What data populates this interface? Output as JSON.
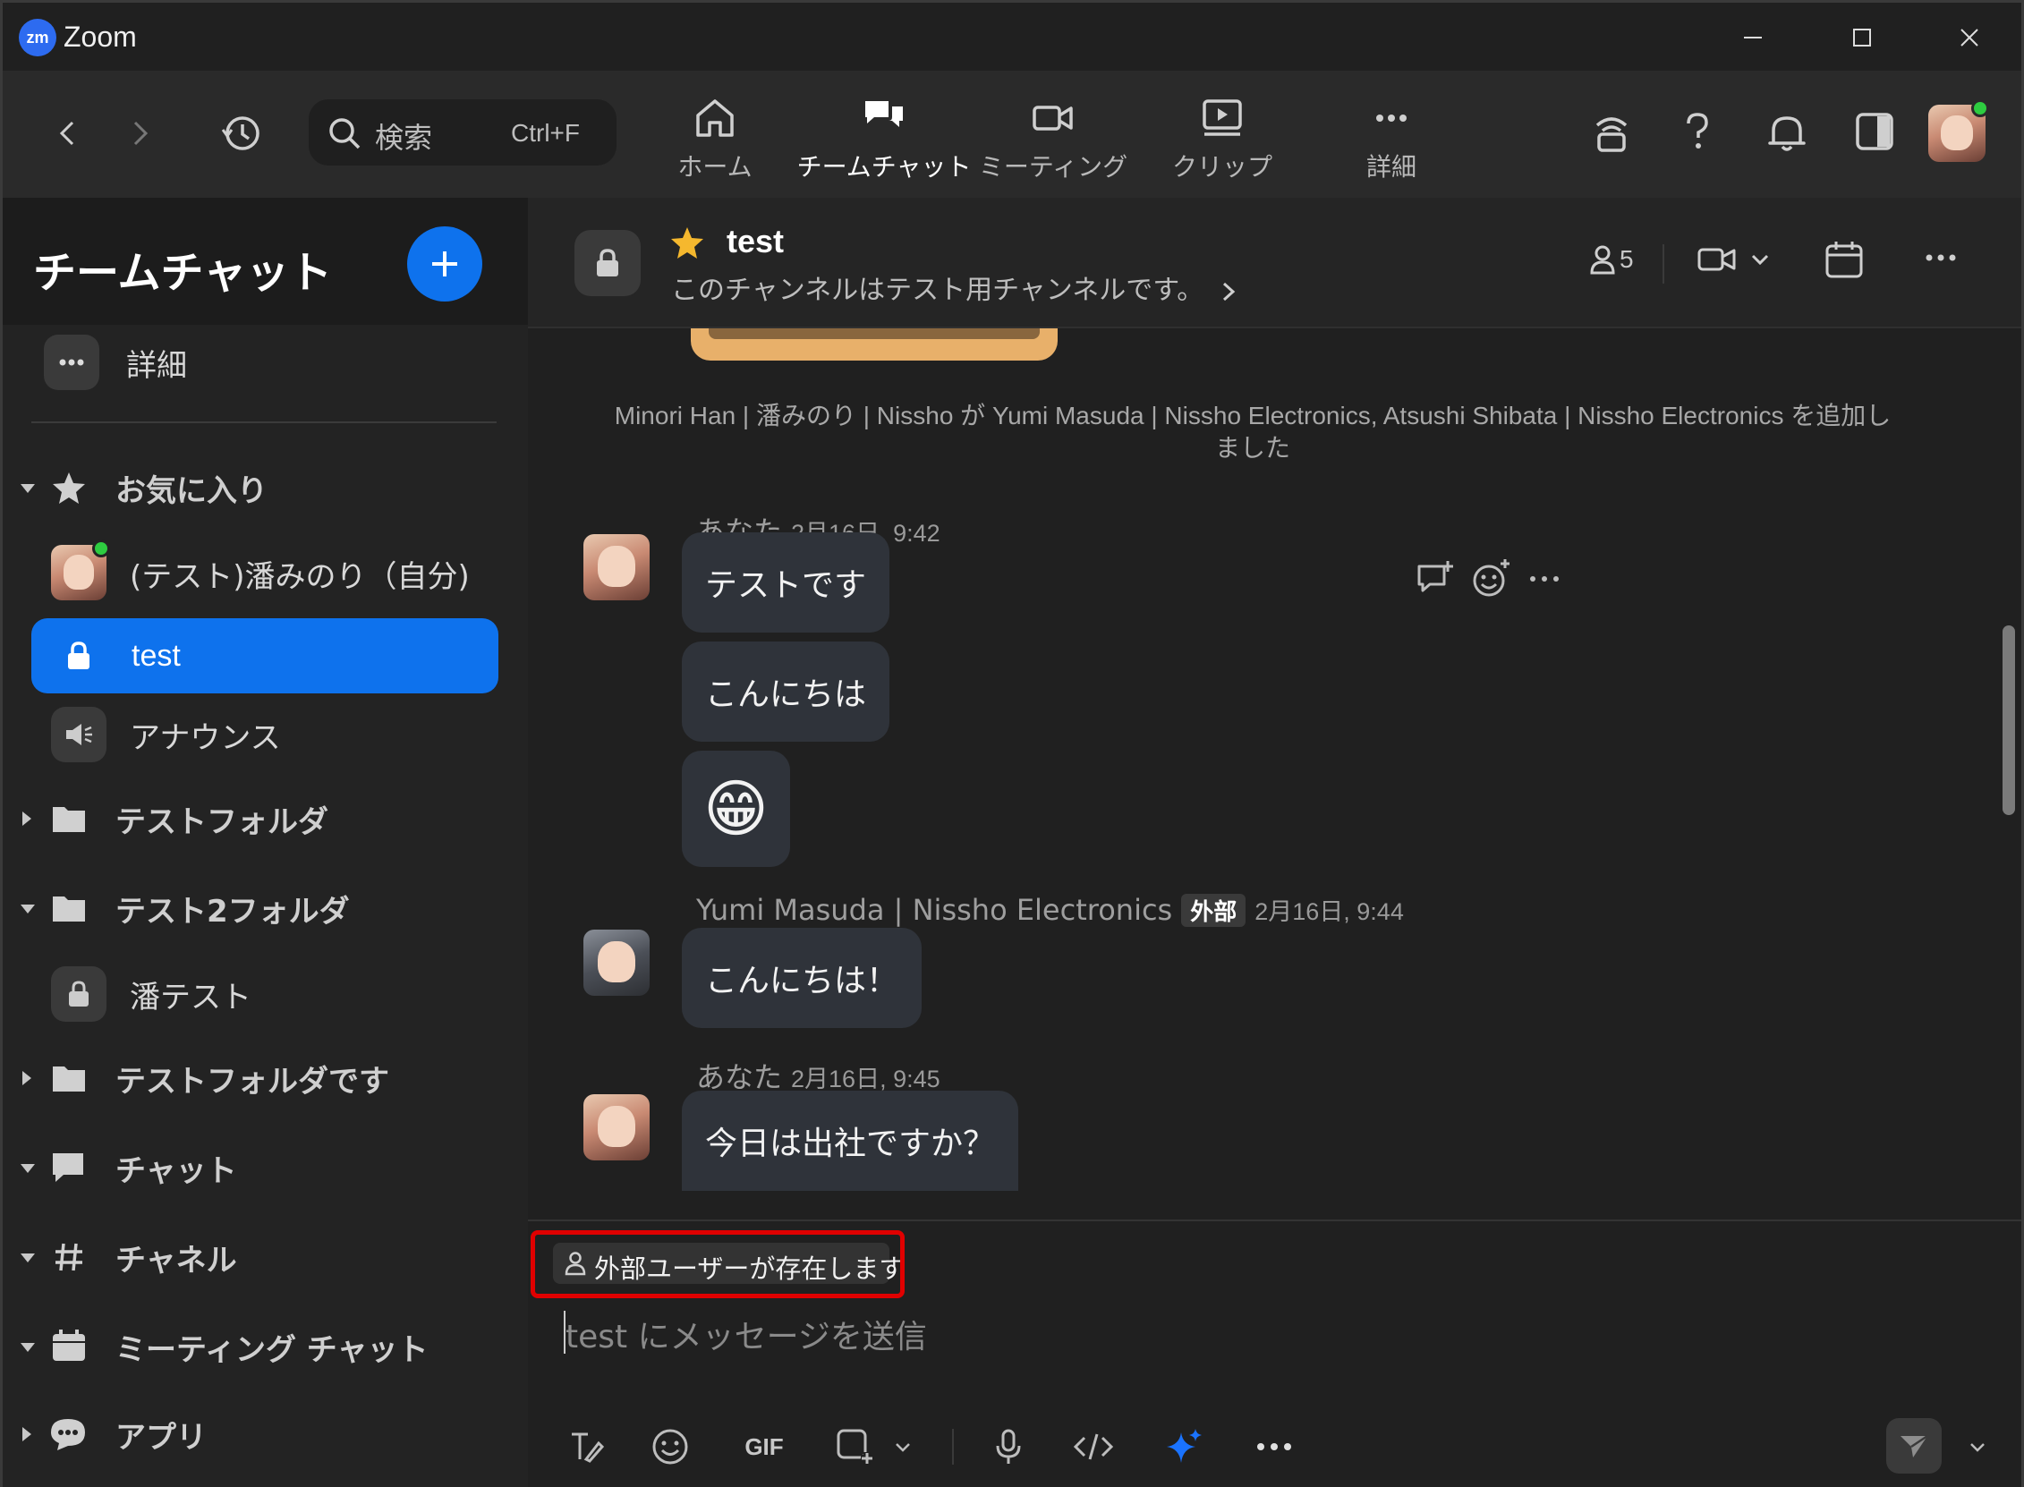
{
  "window": {
    "title": "Zoom",
    "logo": "zm"
  },
  "toolbar": {
    "search_placeholder": "検索",
    "search_shortcut": "Ctrl+F",
    "tabs": [
      {
        "label": "ホーム",
        "icon": "home-icon"
      },
      {
        "label": "チームチャット",
        "icon": "chat-icon",
        "active": true
      },
      {
        "label": "ミーティング",
        "icon": "video-icon"
      },
      {
        "label": "クリップ",
        "icon": "clip-icon"
      },
      {
        "label": "詳細",
        "icon": "more-icon"
      }
    ]
  },
  "sidebar": {
    "title": "チームチャット",
    "more_label": "詳細",
    "favorites_label": "お気に入り",
    "self_label": "(テスト)潘みのり（自分)",
    "active_channel": "test",
    "announce_label": "アナウンス",
    "folder1": "テストフォルダ",
    "folder2": "テスト2フォルダ",
    "folder2_child": "潘テスト",
    "folder3": "テストフォルダです",
    "chat_label": "チャット",
    "channel_label": "チャネル",
    "meeting_chat_label": "ミーティング チャット",
    "apps_label": "アプリ"
  },
  "channel": {
    "name": "test",
    "description": "このチャンネルはテスト用チャンネルです。",
    "member_count": "5"
  },
  "messages": {
    "system": "Minori Han | 潘みのり | Nissho が Yumi Masuda | Nissho Electronics,  Atsushi Shibata | Nissho Electronics を追加しました",
    "group1": {
      "sender": "あなた",
      "time": "2月16日, 9:42",
      "bubbles": [
        "テストです",
        "こんにちは",
        "😁"
      ]
    },
    "group2": {
      "sender": "Yumi Masuda | Nissho Electronics",
      "badge": "外部",
      "time": "2月16日, 9:44",
      "bubbles": [
        "こんにちは！"
      ]
    },
    "group3": {
      "sender": "あなた",
      "time": "2月16日, 9:45",
      "bubbles": [
        "今日は出社ですか？"
      ]
    }
  },
  "compose": {
    "external_notice": "外部ユーザーが存在します",
    "placeholder": "test にメッセージを送信",
    "gif_label": "GIF"
  },
  "colors": {
    "accent": "#0e72ed",
    "highlight_border": "#e00000",
    "online": "#2ecc40"
  }
}
